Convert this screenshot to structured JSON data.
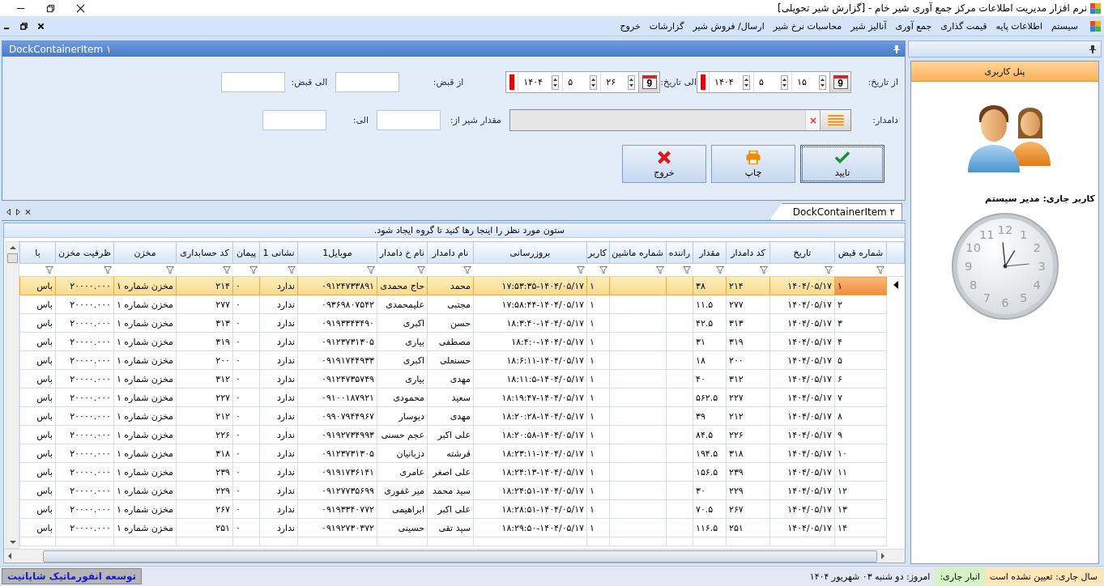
{
  "window": {
    "title": "نرم افزار مدیریت اطلاعات مرکز جمع آوری شیر خام - [گزارش شیر تحویلی]"
  },
  "menu": [
    {
      "label": "سیستم"
    },
    {
      "label": "اطلاعات پایه"
    },
    {
      "label": "قیمت گذاری"
    },
    {
      "label": "جمع آوری"
    },
    {
      "label": "آنالیز شیر"
    },
    {
      "label": "محاسبات نرخ شیر"
    },
    {
      "label": "ارسال/ فروش شیر"
    },
    {
      "label": "گزارشات"
    },
    {
      "label": "خروج"
    }
  ],
  "filter_panel": {
    "title": "DockContainerItem ۱",
    "from_date": {
      "label": "از تاریخ:",
      "icon_day": "9",
      "day": "۱۵",
      "month": "۵",
      "year": "۱۴۰۴"
    },
    "to_date": {
      "label": "الی تاریخ:",
      "icon_day": "9",
      "day": "۲۶",
      "month": "۵",
      "year": "۱۴۰۴"
    },
    "from_receipt": {
      "label": "از قبض:"
    },
    "to_receipt": {
      "label": "الی قبض:"
    },
    "rancher": {
      "label": "دامدار:"
    },
    "milk_from": {
      "label": "مقدار شیر از:"
    },
    "milk_to": {
      "label": "الی:"
    },
    "buttons": [
      {
        "kind": "confirm",
        "label": "تایید",
        "selected": true
      },
      {
        "kind": "print",
        "label": "چاپ",
        "selected": false
      },
      {
        "kind": "exit",
        "label": "خروج",
        "selected": false
      }
    ]
  },
  "grid_panel": {
    "tab": "DockContainerItem ۲",
    "group_hint": "ستون مورد نظر را اینجا رها کنید تا گروه ایجاد شود.",
    "columns": [
      "شماره قبض",
      "تاریخ",
      "کد دامدار",
      "مقدار",
      "راننده",
      "شماره ماشین",
      "کاربر",
      "بروزرسانی",
      "نام دامدار",
      "نام خ دامدار",
      "موبایل1",
      "نشانی 1",
      "پیمان",
      "کد حسابداری",
      "مخزن",
      "ظرفیت مخزن",
      "با"
    ],
    "rows": [
      {
        "selected": true,
        "cells": [
          "۱",
          "۱۴۰۴/۰۵/۱۷",
          "۲۱۴",
          "۳۸",
          "",
          "",
          "۱",
          "۱۷:۵۳:۳۵-۱۴۰۴/۰۵/۱۷",
          "محمد",
          "حاج محمدی",
          "۰۹۱۲۴۷۳۳۸۹۱",
          "ندارد",
          "۰",
          "۲۱۴",
          "مخزن شماره ۱",
          "۲۰۰۰۰.۰۰۰",
          "باس"
        ]
      },
      {
        "selected": false,
        "cells": [
          "۲",
          "۱۴۰۴/۰۵/۱۷",
          "۲۷۷",
          "۱۱.۵",
          "",
          "",
          "۱",
          "۱۷:۵۸:۴۴-۱۴۰۴/۰۵/۱۷",
          "مجتبی",
          "علیمحمدی",
          "۰۹۳۶۹۸۰۷۵۴۲",
          "ندارد",
          "۰",
          "۲۷۷",
          "مخزن شماره ۱",
          "۲۰۰۰۰.۰۰۰",
          "باس"
        ]
      },
      {
        "selected": false,
        "cells": [
          "۳",
          "۱۴۰۴/۰۵/۱۷",
          "۳۱۳",
          "۴۲.۵",
          "",
          "",
          "۱",
          "۱۸:۳:۴۰-۱۴۰۴/۰۵/۱۷",
          "حسن",
          "اکبری",
          "۰۹۱۹۳۳۴۳۴۹۰",
          "ندارد",
          "۰",
          "۳۱۳",
          "مخزن شماره ۱",
          "۲۰۰۰۰.۰۰۰",
          "باس"
        ]
      },
      {
        "selected": false,
        "cells": [
          "۴",
          "۱۴۰۴/۰۵/۱۷",
          "۳۱۹",
          "۳۱",
          "",
          "",
          "۱",
          "۱۸:۴:۰-۱۴۰۴/۰۵/۱۷",
          "مصطفی",
          "بیاری",
          "۰۹۱۲۳۷۳۱۳۰۵",
          "ندارد",
          "۰",
          "۳۱۹",
          "مخزن شماره ۱",
          "۲۰۰۰۰.۰۰۰",
          "باس"
        ]
      },
      {
        "selected": false,
        "cells": [
          "۵",
          "۱۴۰۴/۰۵/۱۷",
          "۲۰۰",
          "۱۸",
          "",
          "",
          "۱",
          "۱۸:۶:۱۱-۱۴۰۴/۰۵/۱۷",
          "حسنعلی",
          "اکبری",
          "۰۹۱۹۱۷۴۴۹۳۳",
          "ندارد",
          "۰",
          "۲۰۰",
          "مخزن شماره ۱",
          "۲۰۰۰۰.۰۰۰",
          "باس"
        ]
      },
      {
        "selected": false,
        "cells": [
          "۶",
          "۱۴۰۴/۰۵/۱۷",
          "۳۱۲",
          "۴۰",
          "",
          "",
          "۱",
          "۱۸:۱۱:۵-۱۴۰۴/۰۵/۱۷",
          "مهدی",
          "بیاری",
          "۰۹۱۲۴۷۳۵۷۴۹",
          "ندارد",
          "۰",
          "۳۱۲",
          "مخزن شماره ۱",
          "۲۰۰۰۰.۰۰۰",
          "باس"
        ]
      },
      {
        "selected": false,
        "cells": [
          "۷",
          "۱۴۰۴/۰۵/۱۷",
          "۲۲۷",
          "۵۶۲.۵",
          "",
          "",
          "۱",
          "۱۸:۱۹:۴۷-۱۴۰۴/۰۵/۱۷",
          "سعید",
          "محمودی",
          "۰۹۱۰۰۱۸۷۹۲۱",
          "ندارد",
          "۰",
          "۲۲۷",
          "مخزن شماره ۱",
          "۲۰۰۰۰.۰۰۰",
          "باس"
        ]
      },
      {
        "selected": false,
        "cells": [
          "۸",
          "۱۴۰۴/۰۵/۱۷",
          "۲۱۲",
          "۳۹",
          "",
          "",
          "۱",
          "۱۸:۲۰:۲۸-۱۴۰۴/۰۵/۱۷",
          "مهدی",
          "دیوسار",
          "۰۹۹۰۷۹۴۴۹۶۷",
          "ندارد",
          "۰",
          "۲۱۲",
          "مخزن شماره ۱",
          "۲۰۰۰۰.۰۰۰",
          "باس"
        ]
      },
      {
        "selected": false,
        "cells": [
          "۹",
          "۱۴۰۴/۰۵/۱۷",
          "۲۲۶",
          "۸۴.۵",
          "",
          "",
          "۱",
          "۱۸:۲۰:۵۸-۱۴۰۴/۰۵/۱۷",
          "علی اکبر",
          "عجم حسنی",
          "۰۹۱۹۲۷۳۴۹۹۳",
          "ندارد",
          "۰",
          "۲۲۶",
          "مخزن شماره ۱",
          "۲۰۰۰۰.۰۰۰",
          "باس"
        ]
      },
      {
        "selected": false,
        "cells": [
          "۱۰",
          "۱۴۰۴/۰۵/۱۷",
          "۳۱۸",
          "۱۹۴.۵",
          "",
          "",
          "۱",
          "۱۸:۲۳:۱۱-۱۴۰۴/۰۵/۱۷",
          "فرشته",
          "دزبانیان",
          "۰۹۱۲۳۷۳۱۳۰۵",
          "ندارد",
          "۰",
          "۳۱۸",
          "مخزن شماره ۱",
          "۲۰۰۰۰.۰۰۰",
          "باس"
        ]
      },
      {
        "selected": false,
        "cells": [
          "۱۱",
          "۱۴۰۴/۰۵/۱۷",
          "۲۳۹",
          "۱۵۶.۵",
          "",
          "",
          "۱",
          "۱۸:۲۴:۱۳-۱۴۰۴/۰۵/۱۷",
          "علی اصغر",
          "عامری",
          "۰۹۱۹۱۷۳۶۱۴۱",
          "ندارد",
          "۰",
          "۲۳۹",
          "مخزن شماره ۱",
          "۲۰۰۰۰.۰۰۰",
          "باس"
        ]
      },
      {
        "selected": false,
        "cells": [
          "۱۲",
          "۱۴۰۴/۰۵/۱۷",
          "۲۲۹",
          "۳۰",
          "",
          "",
          "۱",
          "۱۸:۲۴:۵۱-۱۴۰۴/۰۵/۱۷",
          "سید محمد",
          "میر غفوری",
          "۰۹۱۲۷۷۳۵۶۹۹",
          "ندارد",
          "۰",
          "۲۲۹",
          "مخزن شماره ۱",
          "۲۰۰۰۰.۰۰۰",
          "باس"
        ]
      },
      {
        "selected": false,
        "cells": [
          "۱۳",
          "۱۴۰۴/۰۵/۱۷",
          "۲۶۷",
          "۷۰.۵",
          "",
          "",
          "۱",
          "۱۸:۲۸:۵۱-۱۴۰۴/۰۵/۱۷",
          "علی اکبر",
          "ابراهیمی",
          "۰۹۱۹۳۳۴۰۷۷۲",
          "ندارد",
          "۰",
          "۲۶۷",
          "مخزن شماره ۱",
          "۲۰۰۰۰.۰۰۰",
          "باس"
        ]
      },
      {
        "selected": false,
        "cells": [
          "۱۴",
          "۱۴۰۴/۰۵/۱۷",
          "۲۵۱",
          "۱۱۶.۵",
          "",
          "",
          "۱",
          "۱۸:۲۹:۵۰-۱۴۰۴/۰۵/۱۷",
          "سید تقی",
          "حسینی",
          "۰۹۱۹۲۷۳۰۳۷۲",
          "ندارد",
          "۰",
          "۲۵۱",
          "مخزن شماره ۱",
          "۲۰۰۰۰.۰۰۰",
          "باس"
        ]
      }
    ]
  },
  "user_panel": {
    "title": "پنل کاربری",
    "current_user": "کاربر جاری: مدیر سیستم",
    "clock_numbers": [
      "11",
      "12",
      "1",
      "10",
      "2",
      "9",
      "3",
      "8",
      "4",
      "7",
      "6",
      "5"
    ]
  },
  "status_bar": {
    "year": "سال جاری: تعیین نشده است",
    "warehouse": "انبار جاری:",
    "today": "امروز: دو شنبه ۰۳ شهریور ۱۴۰۴",
    "developer": "توسعه انفورماتیک شایانیت"
  }
}
